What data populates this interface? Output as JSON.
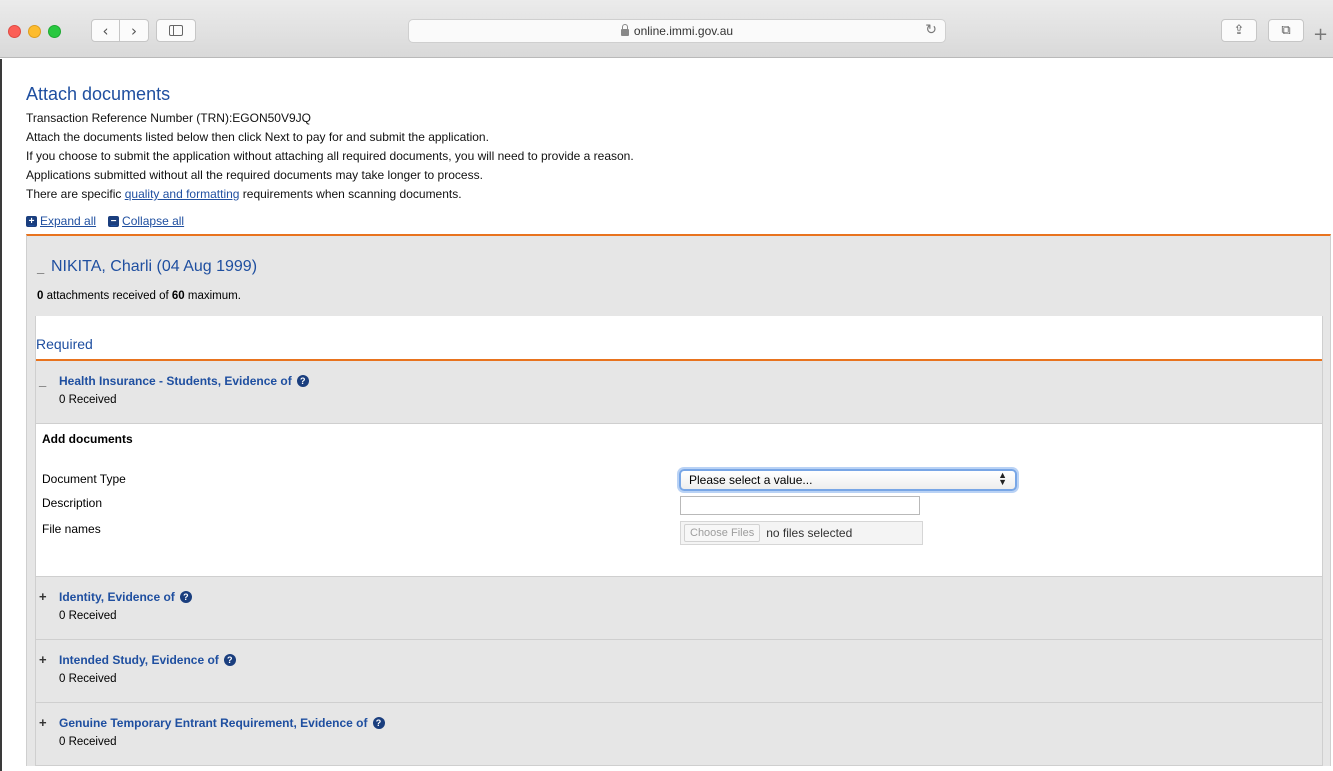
{
  "browser": {
    "url": "online.immi.gov.au"
  },
  "page": {
    "title": "Attach documents",
    "trn_line": "Transaction Reference Number (TRN):EGON50V9JQ",
    "instructions": [
      "Attach the documents listed below then click Next to pay for and submit the application.",
      "If you choose to submit the application without attaching all required documents, you will need to provide a reason.",
      "Applications submitted without all the required documents may take longer to process."
    ],
    "quality_prefix": "There are specific ",
    "quality_link": "quality and formatting",
    "quality_suffix": " requirements when scanning documents.",
    "expand_all": "Expand all",
    "collapse_all": "Collapse all"
  },
  "applicant": {
    "name": "NIKITA, Charli (04 Aug 1999)",
    "received_count": "0",
    "received_mid": " attachments received of ",
    "max_count": "60",
    "received_suffix": " maximum."
  },
  "required_heading": "Required",
  "sections": [
    {
      "title": "Health Insurance - Students, Evidence of",
      "received": "0 Received",
      "toggle": "_"
    },
    {
      "title": "Identity, Evidence of",
      "received": "0 Received",
      "toggle": "+"
    },
    {
      "title": "Intended Study, Evidence of",
      "received": "0 Received",
      "toggle": "+"
    },
    {
      "title": "Genuine Temporary Entrant Requirement, Evidence of",
      "received": "0 Received",
      "toggle": "+"
    }
  ],
  "add_documents": {
    "title": "Add documents",
    "document_type_label": "Document Type",
    "document_type_value": "Please select a value...",
    "description_label": "Description",
    "file_names_label": "File names",
    "choose_files_label": "Choose Files",
    "file_status": "no files selected"
  },
  "colors": {
    "accent_orange": "#e8731e",
    "link_blue": "#1f4fa0",
    "section_gray": "#e6e6e6"
  }
}
